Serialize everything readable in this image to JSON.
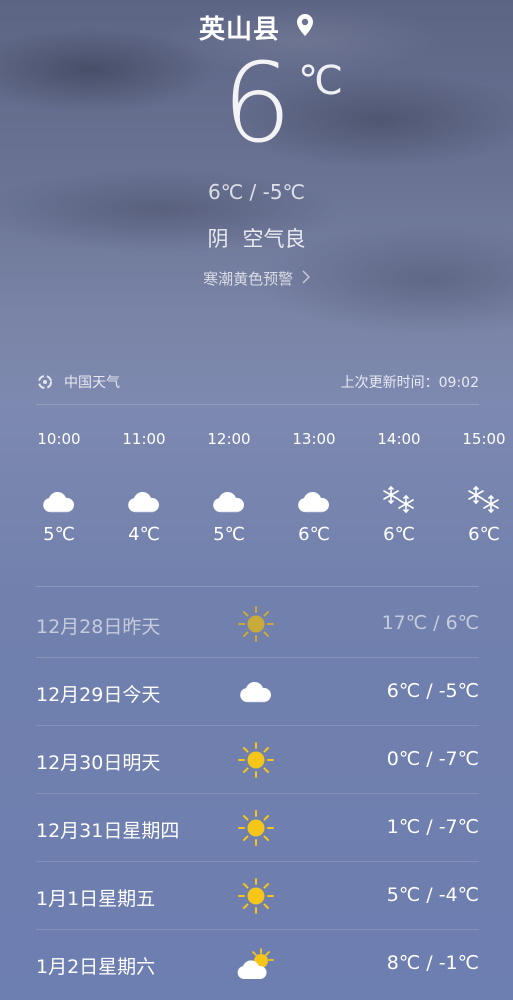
{
  "header": {
    "city": "英山县",
    "location_icon": "location-pin-icon"
  },
  "current": {
    "temperature": "6",
    "unit": "℃",
    "range": "6℃ / -5℃",
    "condition": "阴",
    "air_quality": "空气良",
    "alert": "寒潮黄色预警"
  },
  "source": {
    "name": "中国天气",
    "update_label": "上次更新时间：09:02"
  },
  "hourly": [
    {
      "time": "10:00",
      "icon": "cloudy-icon",
      "temp": "5℃"
    },
    {
      "time": "11:00",
      "icon": "cloudy-icon",
      "temp": "4℃"
    },
    {
      "time": "12:00",
      "icon": "cloudy-icon",
      "temp": "5℃"
    },
    {
      "time": "13:00",
      "icon": "cloudy-icon",
      "temp": "6℃"
    },
    {
      "time": "14:00",
      "icon": "snow-icon",
      "temp": "6℃"
    },
    {
      "time": "15:00",
      "icon": "snow-icon",
      "temp": "6℃"
    }
  ],
  "daily": [
    {
      "date": "12月28日昨天",
      "icon": "sunny-icon",
      "temp": "17℃ / 6℃",
      "past": true
    },
    {
      "date": "12月29日今天",
      "icon": "cloudy-icon",
      "temp": "6℃ / -5℃",
      "past": false
    },
    {
      "date": "12月30日明天",
      "icon": "sunny-icon",
      "temp": "0℃ / -7℃",
      "past": false
    },
    {
      "date": "12月31日星期四",
      "icon": "sunny-icon",
      "temp": "1℃ / -7℃",
      "past": false
    },
    {
      "date": "1月1日星期五",
      "icon": "sunny-icon",
      "temp": "5℃ / -4℃",
      "past": false
    },
    {
      "date": "1月2日星期六",
      "icon": "partly-cloudy-icon",
      "temp": "8℃ / -1℃",
      "past": false
    }
  ],
  "colors": {
    "sun": "#f5c518",
    "cloud": "#ffffff",
    "background": "#7180ad"
  }
}
